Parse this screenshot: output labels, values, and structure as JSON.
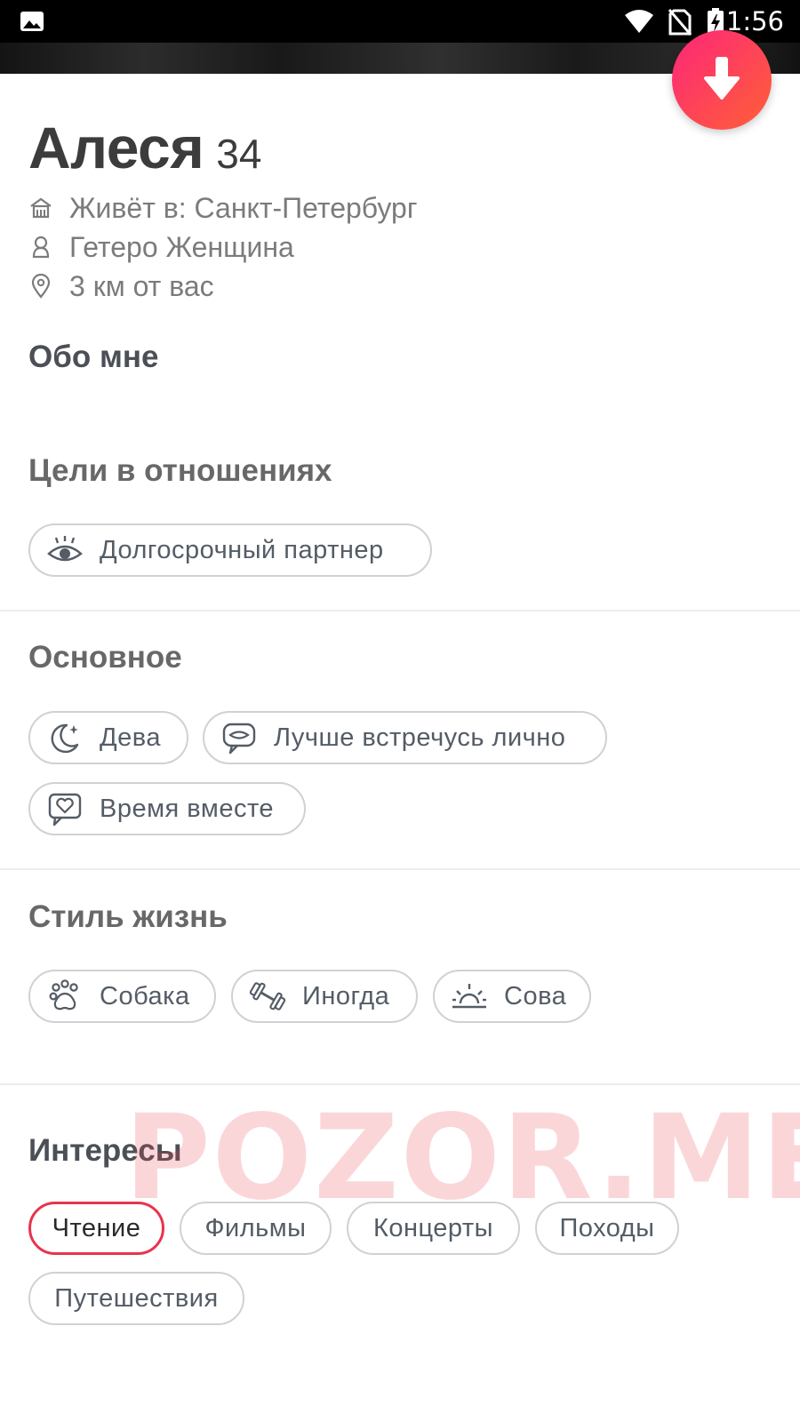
{
  "status_bar": {
    "time": "1:56",
    "icons": [
      "gallery-icon",
      "wifi-icon",
      "no-sim-icon",
      "battery-charging-icon"
    ]
  },
  "profile": {
    "name": "Алеся",
    "age": "34",
    "lives_in": "Живёт в: Санкт-Петербург",
    "orientation_gender": "Гетеро Женщина",
    "distance": "3 км от вас"
  },
  "sections": {
    "about": {
      "title": "Обо мне"
    },
    "goals": {
      "title": "Цели в отношениях",
      "chips": [
        {
          "icon": "eyes-icon",
          "label": "Долгосрочный партнер"
        }
      ]
    },
    "basics": {
      "title": "Основное",
      "chips": [
        {
          "icon": "moon-stars-icon",
          "label": "Дева"
        },
        {
          "icon": "chat-bubble-icon",
          "label": "Лучше встречусь лично"
        },
        {
          "icon": "heart-message-icon",
          "label": "Время вместе"
        }
      ]
    },
    "lifestyle": {
      "title": "Стиль жизнь",
      "chips": [
        {
          "icon": "paw-icon",
          "label": "Собака"
        },
        {
          "icon": "dumbbell-icon",
          "label": "Иногда"
        },
        {
          "icon": "sunset-icon",
          "label": "Сова"
        }
      ]
    },
    "interests": {
      "title": "Интересы",
      "chips": [
        "Чтение",
        "Фильмы",
        "Концерты",
        "Походы",
        "Путешествия"
      ],
      "selected": "Чтение"
    }
  },
  "watermark": "POZOR.ME",
  "colors": {
    "accent_start": "#fd267a",
    "accent_end": "#ff6036",
    "selected_chip_border": "#e8344c",
    "chip_border": "#cfd1d4"
  }
}
